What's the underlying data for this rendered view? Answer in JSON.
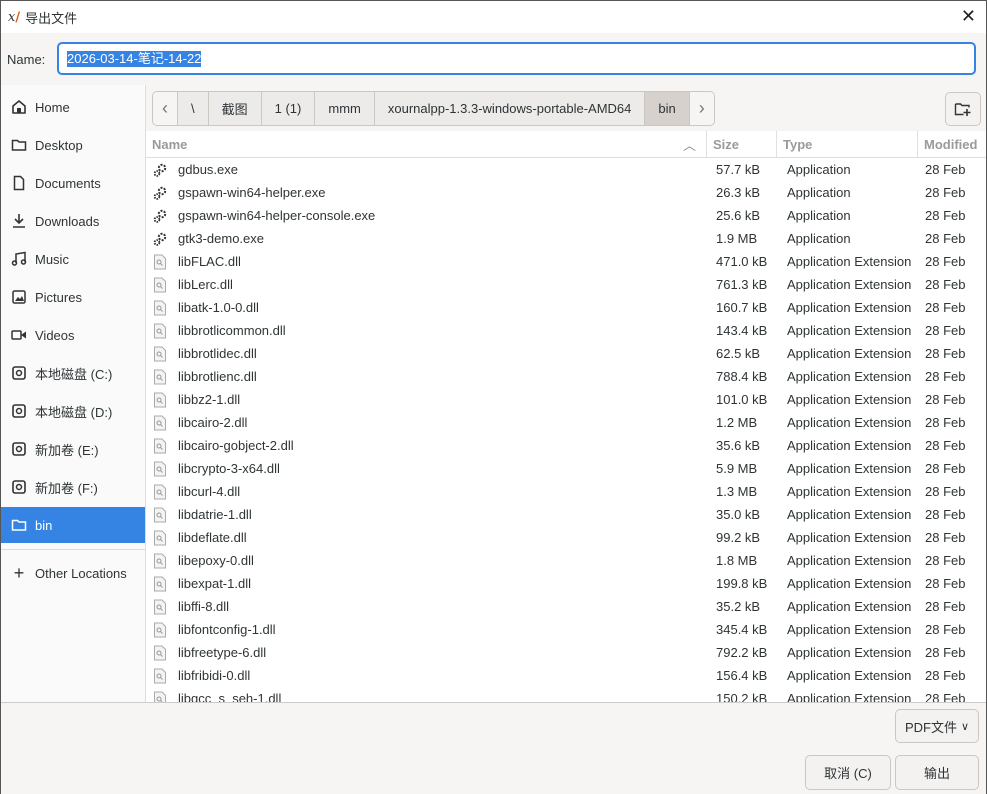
{
  "window": {
    "title": "导出文件",
    "app_icon": "xournalpp-icon"
  },
  "name_field": {
    "label": "Name:",
    "value": "2026-03-14-笔记-14-22"
  },
  "sidebar": {
    "items": [
      {
        "label": "Home",
        "icon": "home-icon"
      },
      {
        "label": "Desktop",
        "icon": "folder-icon"
      },
      {
        "label": "Documents",
        "icon": "document-icon"
      },
      {
        "label": "Downloads",
        "icon": "download-icon"
      },
      {
        "label": "Music",
        "icon": "music-icon"
      },
      {
        "label": "Pictures",
        "icon": "picture-icon"
      },
      {
        "label": "Videos",
        "icon": "video-icon"
      },
      {
        "label": "本地磁盘 (C:)",
        "icon": "drive-icon"
      },
      {
        "label": "本地磁盘 (D:)",
        "icon": "drive-icon"
      },
      {
        "label": "新加卷 (E:)",
        "icon": "drive-icon"
      },
      {
        "label": "新加卷 (F:)",
        "icon": "drive-icon"
      },
      {
        "label": "bin",
        "icon": "folder-icon",
        "selected": true
      }
    ],
    "other_locations": "Other Locations"
  },
  "pathbar": {
    "segments": [
      "\\",
      "截图",
      "1 (1)",
      "mmm",
      "xournalpp-1.3.3-windows-portable-AMD64",
      "bin"
    ],
    "selected": "bin"
  },
  "columns": {
    "name": "Name",
    "size": "Size",
    "type": "Type",
    "modified": "Modified"
  },
  "files": [
    {
      "name": "gdbus.exe",
      "size": "57.7 kB",
      "type": "Application",
      "modified": "28 Feb",
      "icon": "exe"
    },
    {
      "name": "gspawn-win64-helper.exe",
      "size": "26.3 kB",
      "type": "Application",
      "modified": "28 Feb",
      "icon": "exe"
    },
    {
      "name": "gspawn-win64-helper-console.exe",
      "size": "25.6 kB",
      "type": "Application",
      "modified": "28 Feb",
      "icon": "exe"
    },
    {
      "name": "gtk3-demo.exe",
      "size": "1.9 MB",
      "type": "Application",
      "modified": "28 Feb",
      "icon": "exe"
    },
    {
      "name": "libFLAC.dll",
      "size": "471.0 kB",
      "type": "Application Extension",
      "modified": "28 Feb",
      "icon": "dll"
    },
    {
      "name": "libLerc.dll",
      "size": "761.3 kB",
      "type": "Application Extension",
      "modified": "28 Feb",
      "icon": "dll"
    },
    {
      "name": "libatk-1.0-0.dll",
      "size": "160.7 kB",
      "type": "Application Extension",
      "modified": "28 Feb",
      "icon": "dll"
    },
    {
      "name": "libbrotlicommon.dll",
      "size": "143.4 kB",
      "type": "Application Extension",
      "modified": "28 Feb",
      "icon": "dll"
    },
    {
      "name": "libbrotlidec.dll",
      "size": "62.5 kB",
      "type": "Application Extension",
      "modified": "28 Feb",
      "icon": "dll"
    },
    {
      "name": "libbrotlienc.dll",
      "size": "788.4 kB",
      "type": "Application Extension",
      "modified": "28 Feb",
      "icon": "dll"
    },
    {
      "name": "libbz2-1.dll",
      "size": "101.0 kB",
      "type": "Application Extension",
      "modified": "28 Feb",
      "icon": "dll"
    },
    {
      "name": "libcairo-2.dll",
      "size": "1.2 MB",
      "type": "Application Extension",
      "modified": "28 Feb",
      "icon": "dll"
    },
    {
      "name": "libcairo-gobject-2.dll",
      "size": "35.6 kB",
      "type": "Application Extension",
      "modified": "28 Feb",
      "icon": "dll"
    },
    {
      "name": "libcrypto-3-x64.dll",
      "size": "5.9 MB",
      "type": "Application Extension",
      "modified": "28 Feb",
      "icon": "dll"
    },
    {
      "name": "libcurl-4.dll",
      "size": "1.3 MB",
      "type": "Application Extension",
      "modified": "28 Feb",
      "icon": "dll"
    },
    {
      "name": "libdatrie-1.dll",
      "size": "35.0 kB",
      "type": "Application Extension",
      "modified": "28 Feb",
      "icon": "dll"
    },
    {
      "name": "libdeflate.dll",
      "size": "99.2 kB",
      "type": "Application Extension",
      "modified": "28 Feb",
      "icon": "dll"
    },
    {
      "name": "libepoxy-0.dll",
      "size": "1.8 MB",
      "type": "Application Extension",
      "modified": "28 Feb",
      "icon": "dll"
    },
    {
      "name": "libexpat-1.dll",
      "size": "199.8 kB",
      "type": "Application Extension",
      "modified": "28 Feb",
      "icon": "dll"
    },
    {
      "name": "libffi-8.dll",
      "size": "35.2 kB",
      "type": "Application Extension",
      "modified": "28 Feb",
      "icon": "dll"
    },
    {
      "name": "libfontconfig-1.dll",
      "size": "345.4 kB",
      "type": "Application Extension",
      "modified": "28 Feb",
      "icon": "dll"
    },
    {
      "name": "libfreetype-6.dll",
      "size": "792.2 kB",
      "type": "Application Extension",
      "modified": "28 Feb",
      "icon": "dll"
    },
    {
      "name": "libfribidi-0.dll",
      "size": "156.4 kB",
      "type": "Application Extension",
      "modified": "28 Feb",
      "icon": "dll"
    },
    {
      "name": "libgcc_s_seh-1.dll",
      "size": "150.2 kB",
      "type": "Application Extension",
      "modified": "28 Feb",
      "icon": "dll"
    }
  ],
  "filter": {
    "label": "PDF文件"
  },
  "buttons": {
    "cancel": "取消 (C)",
    "export": "输出"
  },
  "colors": {
    "accent": "#3584e4"
  }
}
